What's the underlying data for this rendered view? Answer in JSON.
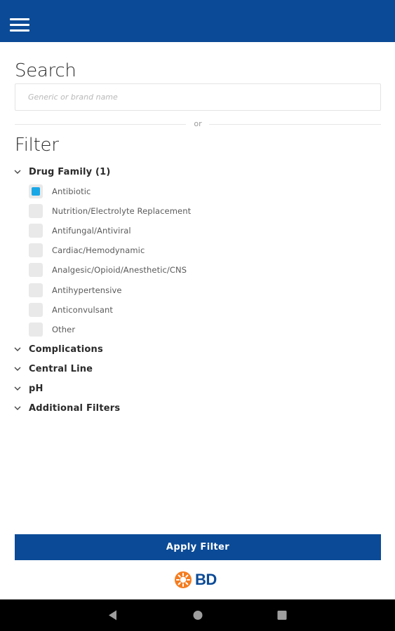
{
  "search": {
    "title": "Search",
    "placeholder": "Generic or brand name",
    "value": ""
  },
  "divider_text": "or",
  "filter": {
    "title": "Filter",
    "drug_family": {
      "label": "Drug Family (1)",
      "options": [
        {
          "label": "Antibiotic",
          "checked": true
        },
        {
          "label": "Nutrition/Electrolyte Replacement",
          "checked": false
        },
        {
          "label": "Antifungal/Antiviral",
          "checked": false
        },
        {
          "label": "Cardiac/Hemodynamic",
          "checked": false
        },
        {
          "label": "Analgesic/Opioid/Anesthetic/CNS",
          "checked": false
        },
        {
          "label": "Antihypertensive",
          "checked": false
        },
        {
          "label": "Anticonvulsant",
          "checked": false
        },
        {
          "label": "Other",
          "checked": false
        }
      ]
    },
    "sections": [
      {
        "label": "Complications"
      },
      {
        "label": "Central Line"
      },
      {
        "label": "pH"
      },
      {
        "label": "Additional Filters"
      }
    ]
  },
  "apply_button": "Apply Filter",
  "logo_text": "BD",
  "colors": {
    "brand": "#0b4a96",
    "checkbox_checked": "#1aa7e6",
    "logo_orange": "#f57c1f"
  },
  "icons": {
    "menu": "hamburger-icon",
    "nav_back": "triangle-back-icon",
    "nav_home": "circle-home-icon",
    "nav_recents": "square-recents-icon"
  }
}
